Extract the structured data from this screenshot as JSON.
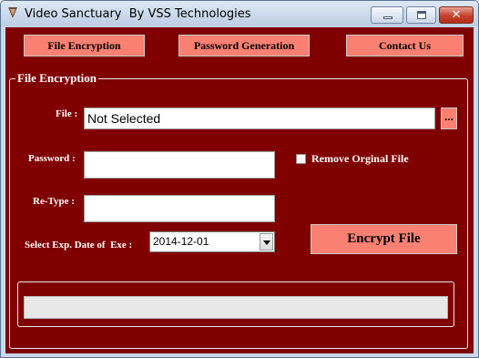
{
  "window": {
    "title": "Video Sanctuary  By VSS Technologies",
    "icon": "app-icon",
    "controls": {
      "minimize": "minimize",
      "maximize": "maximize",
      "close": "✕"
    }
  },
  "nav": {
    "file_encryption": "File Encryption",
    "password_generation": "Password Generation",
    "contact_us": "Contact Us"
  },
  "form": {
    "group_title": "File Encryption",
    "file_label": "File :",
    "file_value": "Not Selected",
    "browse_label": "...",
    "password_label": "Password :",
    "password_value": "",
    "retype_label": "Re-Type :",
    "retype_value": "",
    "remove_original_label": "Remove Orginal File",
    "remove_original_checked": false,
    "exp_date_label": "Select Exp. Date of  Exe :",
    "exp_date_value": "2014-12-01",
    "encrypt_button": "Encrypt File"
  },
  "progress": {
    "value": 0
  },
  "colors": {
    "background": "#800000",
    "button": "#fa8072",
    "label_text": "#ffffff"
  }
}
